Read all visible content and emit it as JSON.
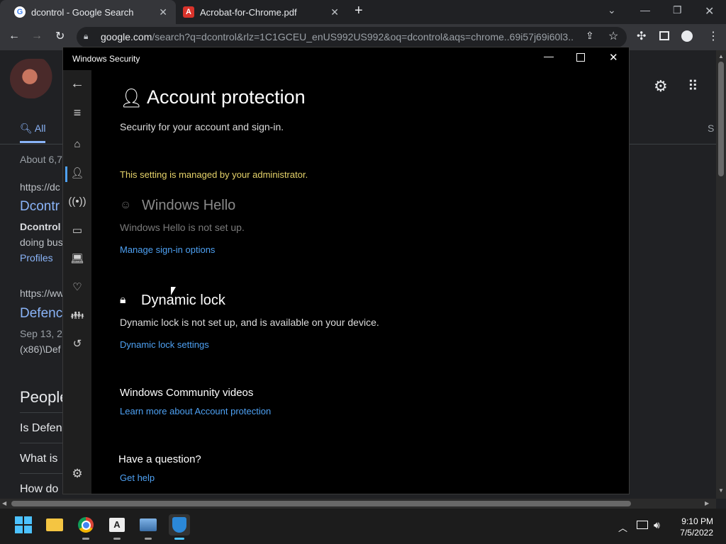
{
  "browser": {
    "tabs": [
      {
        "title": "dcontrol - Google Search",
        "favicon": "G"
      },
      {
        "title": "Acrobat-for-Chrome.pdf"
      }
    ],
    "url_host": "google.com",
    "url_rest": "/search?q=dcontrol&rlz=1C1GCEU_enUS992US992&oq=dcontrol&aqs=chrome..69i57j69i60l3...."
  },
  "google": {
    "tab_all": "All",
    "result_count": "About 6,7",
    "r1_url": "https://dc",
    "r1_title": "Dcontr",
    "r1_snip1": "Dcontrol",
    "r1_snip2": "doing bus",
    "r1_profiles": "Profiles",
    "r2_url": "https://ww",
    "r2_title": "Defenc",
    "r2_date": "Sep 13, 2",
    "r2_snip": "(x86)\\Def",
    "people": "People",
    "paa1": "Is Defen",
    "paa2": "What is",
    "paa3": "How do",
    "s_right": "S"
  },
  "wsec": {
    "title": "Windows Security",
    "heading": "Account protection",
    "subtitle": "Security for your account and sign-in.",
    "admin_notice": "This setting is managed by your administrator.",
    "hello_title": "Windows Hello",
    "hello_status": "Windows Hello is not set up.",
    "hello_link": "Manage sign-in options",
    "dyn_title": "Dynamic lock",
    "dyn_status": "Dynamic lock is not set up, and is available on your device.",
    "dyn_link": "Dynamic lock settings",
    "community_title": "Windows Community videos",
    "community_link": "Learn more about Account protection",
    "question_title": "Have a question?",
    "help_link": "Get help"
  },
  "taskbar": {
    "time": "9:10 PM",
    "date": "7/5/2022"
  },
  "colors": {
    "accent": "#4ea1f3",
    "admin_notice": "#e6d36a"
  }
}
